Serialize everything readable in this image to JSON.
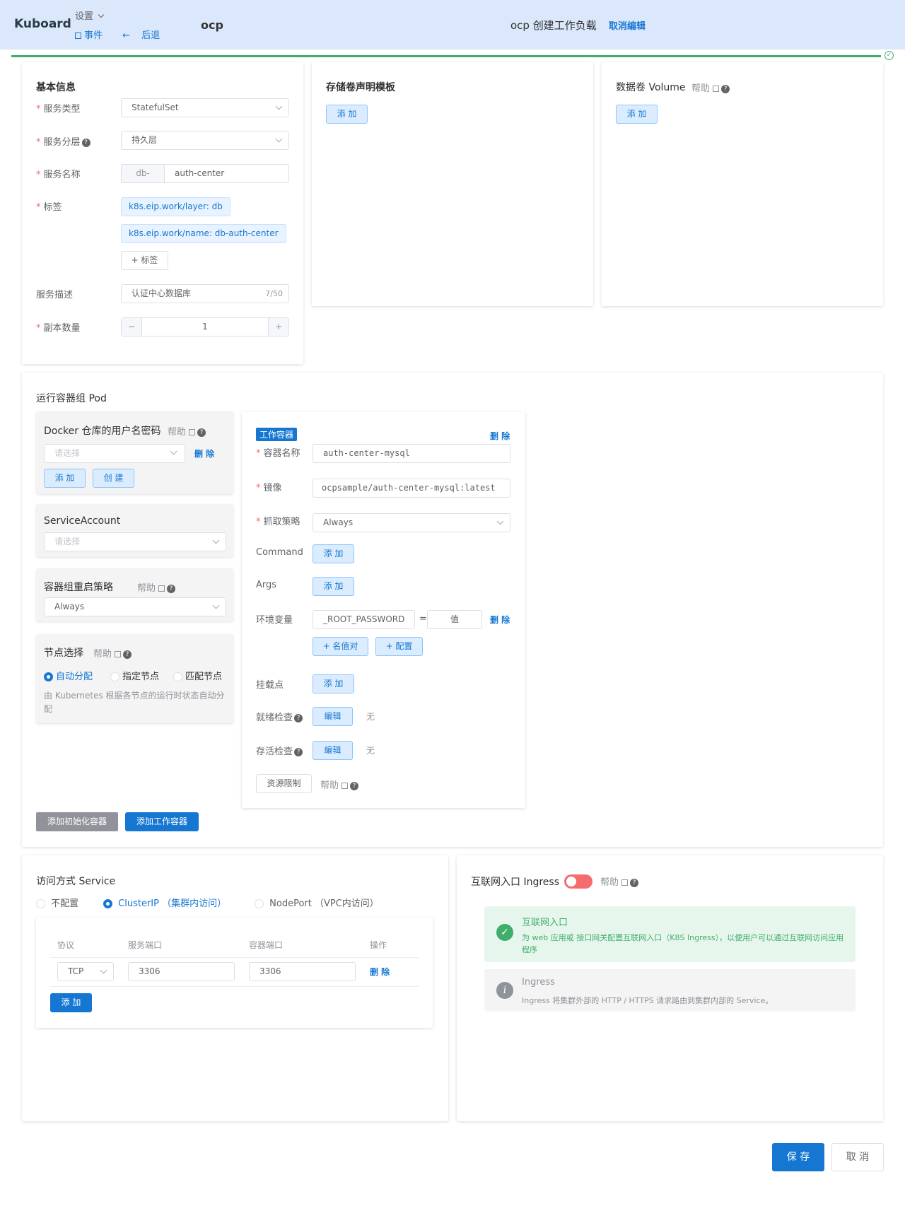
{
  "header": {
    "brand": "Kuboard",
    "settings": "设置",
    "events": "事件",
    "back": "后退",
    "namespace": "ocp",
    "title": "ocp 创建工作负载",
    "cancel_edit": "取消编辑"
  },
  "basic": {
    "title": "基本信息",
    "service_type_label": "服务类型",
    "service_type_value": "StatefulSet",
    "layer_label": "服务分层",
    "layer_value": "持久层",
    "name_label": "服务名称",
    "name_prefix": "db-",
    "name_value": "auth-center",
    "labels_label": "标签",
    "labels": [
      "k8s.eip.work/layer: db",
      "k8s.eip.work/name: db-auth-center"
    ],
    "add_label": "+ 标签",
    "desc_label": "服务描述",
    "desc_value": "认证中心数据库",
    "desc_count": "7/50",
    "replicas_label": "副本数量",
    "replicas_value": "1",
    "minus": "−",
    "plus": "+"
  },
  "pvc": {
    "title": "存储卷声明模板",
    "add": "添 加"
  },
  "volume": {
    "title": "数据卷 Volume",
    "help": "帮助",
    "add": "添 加"
  },
  "pod": {
    "title": "运行容器组 Pod",
    "docker": {
      "title": "Docker 仓库的用户名密码",
      "help": "帮助",
      "placeholder": "请选择",
      "delete": "删 除",
      "add": "添 加",
      "create": "创 建"
    },
    "sa": {
      "title": "ServiceAccount",
      "placeholder": "请选择"
    },
    "restart": {
      "title": "容器组重启策略",
      "help": "帮助",
      "value": "Always"
    },
    "node": {
      "title": "节点选择",
      "help": "帮助",
      "opt1": "自动分配",
      "opt2": "指定节点",
      "opt3": "匹配节点",
      "desc": "由 Kubernetes 根据各节点的运行时状态自动分配"
    },
    "add_init": "添加初始化容器",
    "add_work": "添加工作容器"
  },
  "container": {
    "badge": "工作容器",
    "delete": "删 除",
    "name_label": "容器名称",
    "name_value": "auth-center-mysql",
    "image_label": "镜像",
    "image_value": "ocpsample/auth-center-mysql:latest",
    "pull_label": "抓取策略",
    "pull_value": "Always",
    "command_label": "Command",
    "args_label": "Args",
    "add": "添 加",
    "env_label": "环境变量",
    "env_name": "_ROOT_PASSWORD",
    "env_eq": "=",
    "env_value": "值",
    "env_delete": "删 除",
    "add_pair": "+ 名值对",
    "add_config": "+ 配置",
    "mount_label": "挂载点",
    "ready_label": "就绪检查",
    "live_label": "存活检查",
    "edit": "编辑",
    "none": "无",
    "resources": "资源限制",
    "help": "帮助"
  },
  "service": {
    "title": "访问方式 Service",
    "opt_none": "不配置",
    "opt_cluster": "ClusterIP （集群内访问）",
    "opt_node": "NodePort （VPC内访问）",
    "headers": [
      "协议",
      "服务端口",
      "容器端口",
      "操作"
    ],
    "protocol": "TCP",
    "service_port": "3306",
    "container_port": "3306",
    "delete": "删 除",
    "add": "添 加"
  },
  "ingress": {
    "title": "互联网入口 Ingress",
    "help": "帮助",
    "alert1_title": "互联网入口",
    "alert1_desc": "为 web 应用或 接口网关配置互联网入口（K8S Ingress），以便用户可以通过互联网访问应用程序",
    "alert2_title": "Ingress",
    "alert2_desc": "Ingress 将集群外部的 HTTP / HTTPS 请求路由到集群内部的 Service。"
  },
  "footer": {
    "save": "保 存",
    "cancel": "取 消"
  }
}
